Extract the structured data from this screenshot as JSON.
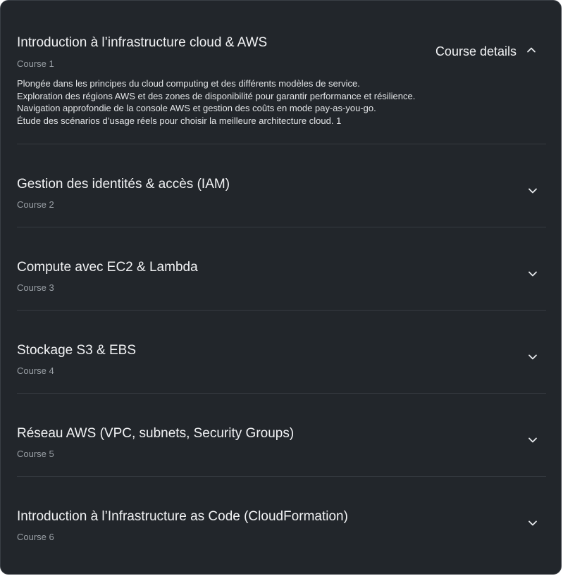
{
  "expanded": {
    "title": "Introduction à l’infrastructure cloud & AWS",
    "course": "Course 1",
    "details_label": "Course details",
    "description": [
      "Plongée dans les principes du cloud computing et des différents modèles de service.",
      "Exploration des régions AWS et des zones de disponibilité pour garantir performance et résilience.",
      "Navigation approfondie de la console AWS et gestion des coûts en mode pay-as-you-go.",
      "Étude des scénarios d’usage réels pour choisir la meilleure architecture cloud. 1"
    ]
  },
  "courses": [
    {
      "title": "Gestion des identités & accès (IAM)",
      "course": "Course 2"
    },
    {
      "title": "Compute avec EC2 & Lambda",
      "course": "Course 3"
    },
    {
      "title": "Stockage S3 & EBS",
      "course": "Course 4"
    },
    {
      "title": "Réseau AWS (VPC, subnets, Security Groups)",
      "course": "Course 5"
    },
    {
      "title": "Introduction à l’Infrastructure as Code (CloudFormation)",
      "course": "Course 6"
    }
  ],
  "icons": {
    "expanded": "chevron-up-icon",
    "collapsed": "chevron-down-icon"
  },
  "colors": {
    "background": "#22262b",
    "text": "#f1f2f4",
    "muted": "#9aa0a6",
    "divider": "#363b41"
  }
}
